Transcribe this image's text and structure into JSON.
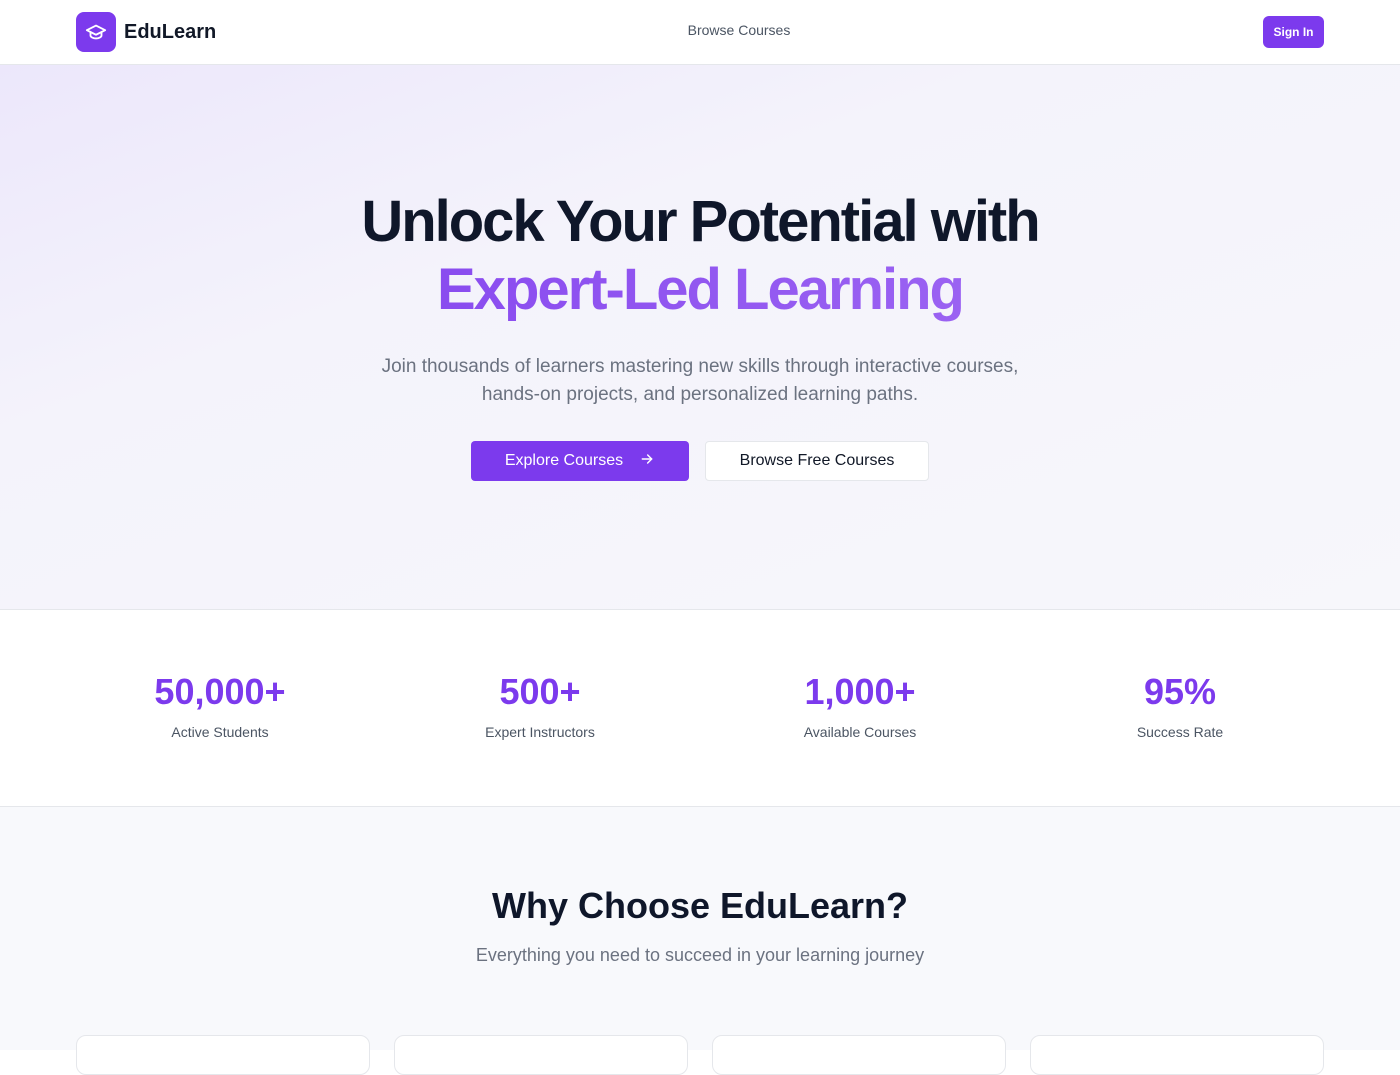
{
  "header": {
    "brand_name": "EduLearn",
    "nav_link": "Browse Courses",
    "signin_label": "Sign In",
    "logo_icon": "graduation-cap-icon"
  },
  "hero": {
    "title_line1": "Unlock Your Potential with",
    "title_line2": "Expert-Led Learning",
    "subtitle_line1": "Join thousands of learners mastering new skills through interactive courses,",
    "subtitle_line2": "hands-on projects, and personalized learning paths.",
    "primary_button": "Explore Courses",
    "primary_button_icon": "arrow-right-icon",
    "secondary_button": "Browse Free Courses"
  },
  "stats": [
    {
      "value": "50,000+",
      "label": "Active Students"
    },
    {
      "value": "500+",
      "label": "Expert Instructors"
    },
    {
      "value": "1,000+",
      "label": "Available Courses"
    },
    {
      "value": "95%",
      "label": "Success Rate"
    }
  ],
  "why": {
    "title": "Why Choose EduLearn?",
    "subtitle": "Everything you need to succeed in your learning journey"
  },
  "colors": {
    "accent": "#7c3aed",
    "accent_light": "#a874f4",
    "text_dark": "#0f172a",
    "text_muted": "#6b7280"
  }
}
